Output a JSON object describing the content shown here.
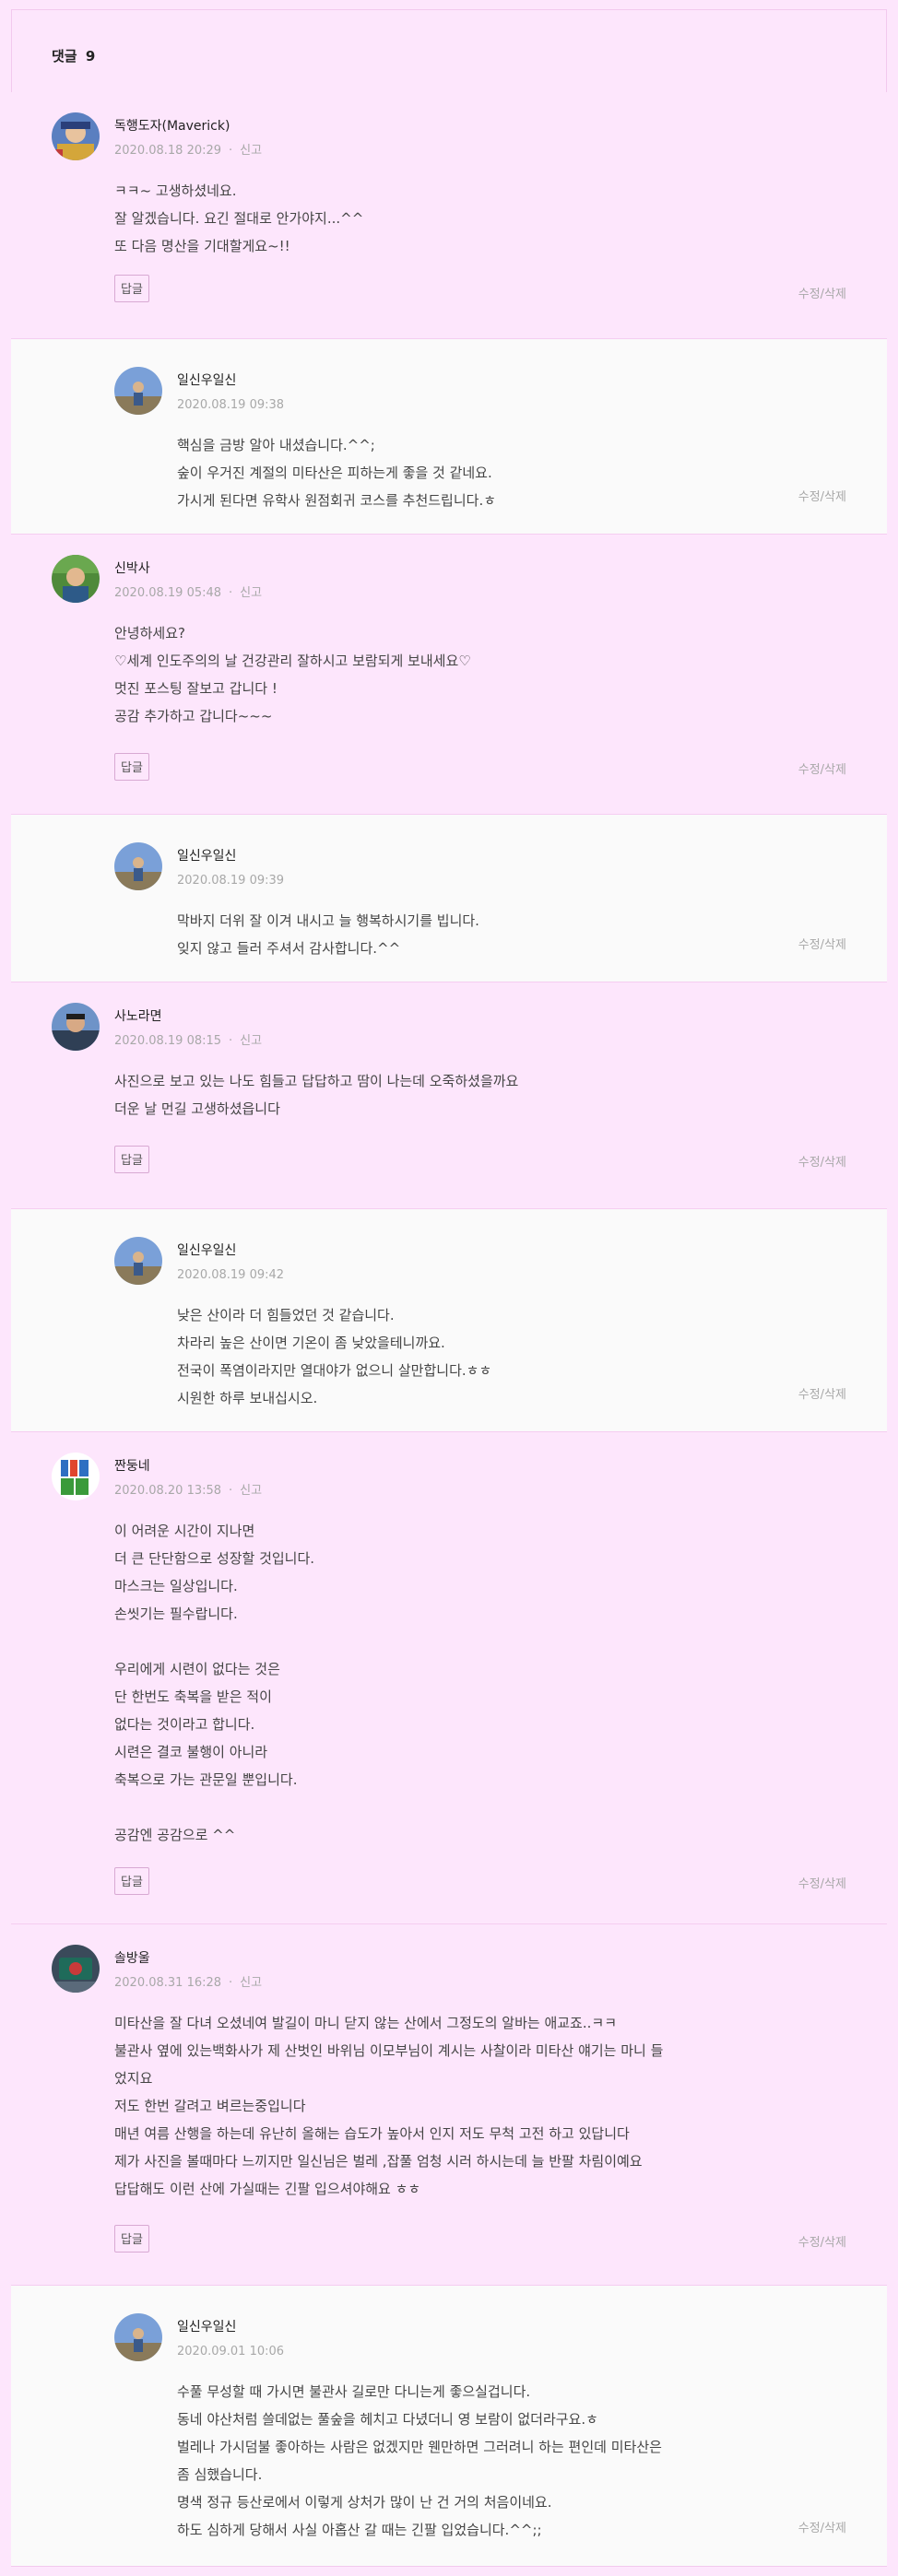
{
  "header": {
    "title": "댓글",
    "count": "9"
  },
  "labels": {
    "report": "신고",
    "reply": "답글",
    "edit_delete": "수정/삭제",
    "dot": "·"
  },
  "comments": [
    {
      "author": "독행도자(Maverick)",
      "datetime": "2020.08.18 20:29",
      "text": "ㅋㅋ~ 고생하셨네요.\n잘 알겠습니다. 요긴 절대로 안가야지...^^\n또 다음 명산을 기대할게요~!!"
    },
    {
      "author": "일신우일신",
      "datetime": "2020.08.19 09:38",
      "text": "핵심을 금방 알아 내셨습니다.^^;\n숲이 우거진 계절의 미타산은 피하는게 좋을 것 같네요.\n가시게 된다면 유학사 원점회귀 코스를 추천드립니다.ㅎ"
    },
    {
      "author": "신박사",
      "datetime": "2020.08.19 05:48",
      "text": "안녕하세요?\n♡세계 인도주의의 날 건강관리 잘하시고 보람되게 보내세요♡\n멋진 포스팅 잘보고 갑니다 !\n공감 추가하고 갑니다~~~"
    },
    {
      "author": "일신우일신",
      "datetime": "2020.08.19 09:39",
      "text": "막바지 더위 잘 이겨 내시고 늘 행복하시기를 빕니다.\n잊지 않고 들러 주셔서 감사합니다.^^"
    },
    {
      "author": "사노라면",
      "datetime": "2020.08.19 08:15",
      "text": "사진으로 보고 있는 나도 힘들고 답답하고 땀이 나는데 오죽하셨을까요\n더운 날 먼길 고생하셨읍니다"
    },
    {
      "author": "일신우일신",
      "datetime": "2020.08.19 09:42",
      "text": "낮은 산이라 더 힘들었던 것 같습니다.\n차라리 높은 산이면 기온이 좀 낮았을테니까요.\n전국이 폭염이라지만 열대야가 없으니 살만합니다.ㅎㅎ\n시원한 하루 보내십시오."
    },
    {
      "author": "짠둥네",
      "datetime": "2020.08.20 13:58",
      "text": "이 어려운 시간이 지나면\n더 큰 단단함으로 성장할 것입니다.\n마스크는 일상입니다.\n손씻기는 필수랍니다.\n\n우리에게 시련이 없다는 것은\n단 한번도 축복을 받은 적이\n없다는 것이라고 합니다.\n시련은 결코 불행이 아니라\n축복으로 가는 관문일 뿐입니다.\n\n공감엔 공감으로 ^^"
    },
    {
      "author": "솔방울",
      "datetime": "2020.08.31 16:28",
      "text": "미타산을 잘 다녀 오셨네여 발길이 마니 닫지 않는 산에서 그정도의 알바는 애교죠..ㅋㅋ\n불관사 옆에 있는백화사가 제 산벗인 바위님 이모부님이 계시는 사찰이라 미타산 얘기는 마니 들\n었지요\n저도 한번 갈려고 벼르는중입니다\n매년 여름 산행을 하는데 유난히 올해는 습도가 높아서 인지 저도 무척 고전 하고 있답니다\n제가 사진을 볼때마다 느끼지만 일신님은 벌레 ,잡풀 엄청 시러 하시는데 늘 반팔 차림이예요\n답답해도 이런 산에 가실때는 긴팔 입으셔야해요 ㅎㅎ"
    },
    {
      "author": "일신우일신",
      "datetime": "2020.09.01 10:06",
      "text": "수풀 무성할 때 가시면 불관사 길로만 다니는게 좋으실겁니다.\n동네 야산처럼 쓸데없는 풀숲을 헤치고 다녔더니 영 보람이 없더라구요.ㅎ\n벌레나 가시덤불 좋아하는 사람은 없겠지만 웬만하면 그러려니 하는 편인데 미타산은\n좀 심했습니다.\n명색 정규 등산로에서 이렇게 상처가 많이 난 건 거의 처음이네요.\n하도 심하게 당해서 사실 아홉산 갈 때는 긴팔 입었습니다.^^;;"
    }
  ]
}
